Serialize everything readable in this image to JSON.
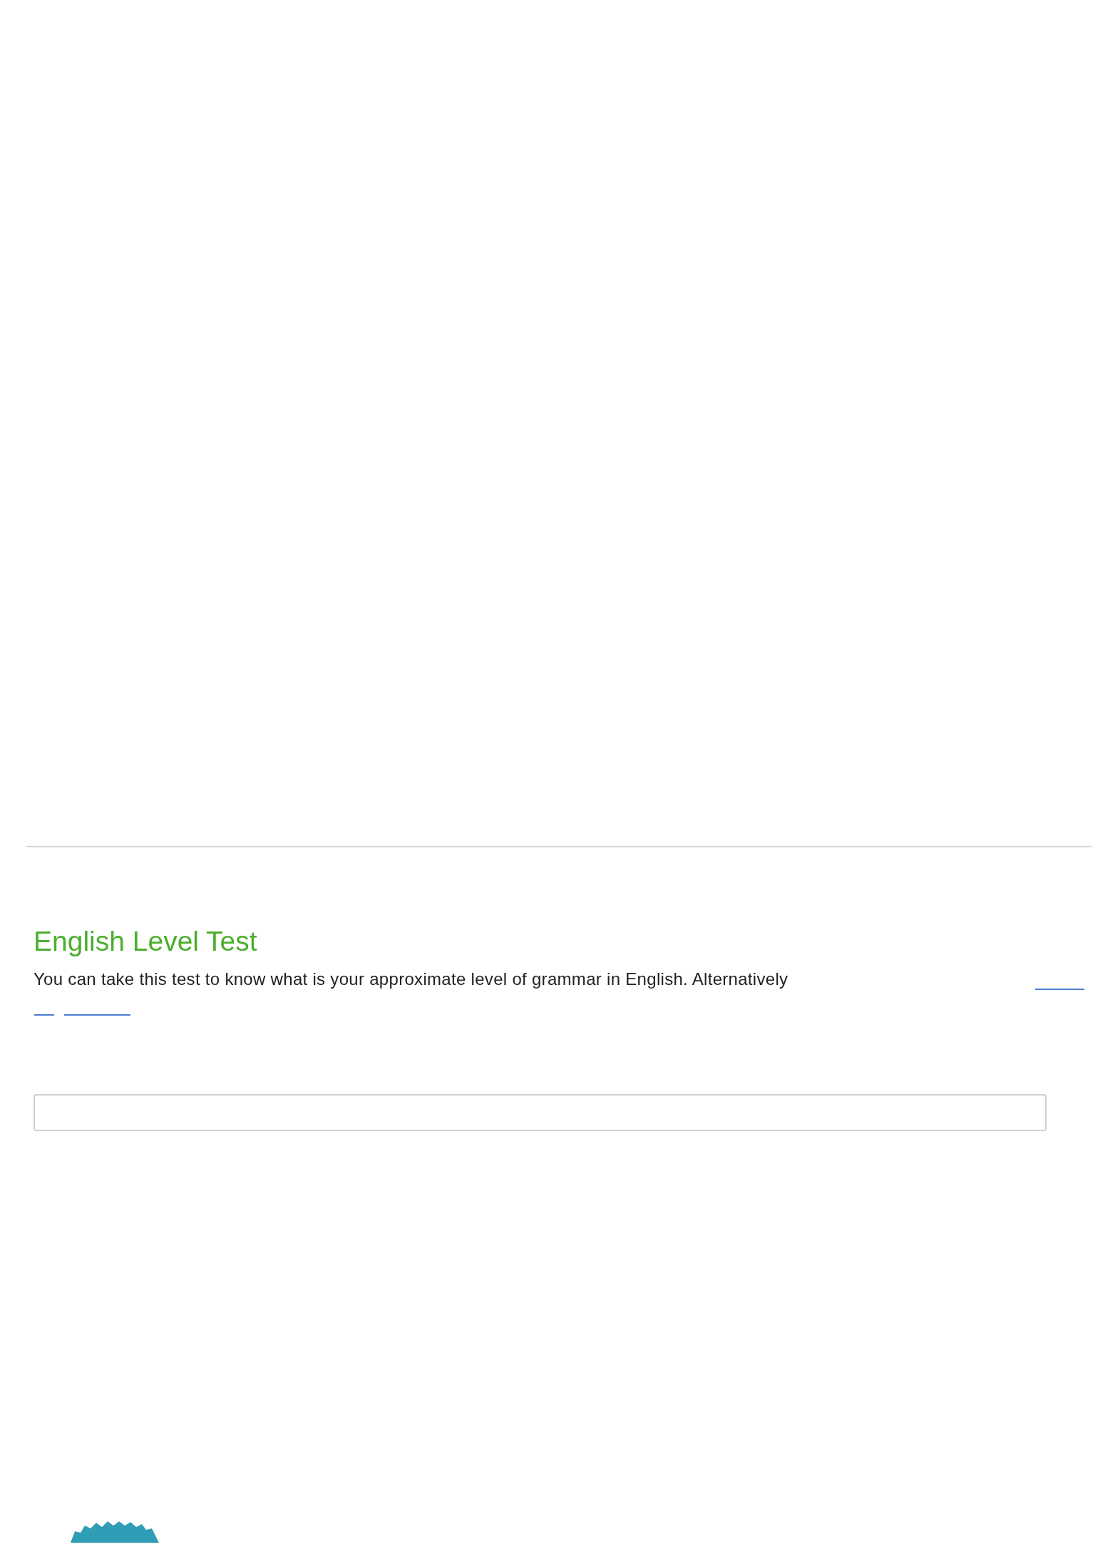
{
  "heading": "English Level Test",
  "intro": "You can take this test to know what is your approximate level of grammar in English. Alternatively"
}
